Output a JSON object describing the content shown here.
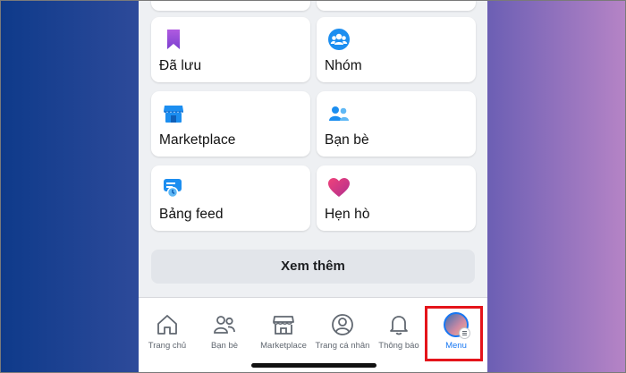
{
  "shortcuts": [
    {
      "label": "Đã lưu",
      "icon": "bookmark-icon"
    },
    {
      "label": "Nhóm",
      "icon": "groups-icon"
    },
    {
      "label": "Marketplace",
      "icon": "marketplace-shop-icon"
    },
    {
      "label": "Bạn bè",
      "icon": "friends-icon"
    },
    {
      "label": "Bảng feed",
      "icon": "feeds-icon"
    },
    {
      "label": "Hẹn hò",
      "icon": "dating-heart-icon"
    }
  ],
  "see_more_label": "Xem thêm",
  "tabbar": {
    "items": [
      {
        "label": "Trang chủ",
        "icon": "home-icon"
      },
      {
        "label": "Bạn bè",
        "icon": "friends-outline-icon"
      },
      {
        "label": "Marketplace",
        "icon": "shop-outline-icon"
      },
      {
        "label": "Trang cá nhân",
        "icon": "profile-icon"
      },
      {
        "label": "Thông báo",
        "icon": "bell-icon"
      },
      {
        "label": "Menu",
        "icon": "avatar-menu-icon"
      }
    ],
    "active_index": 5
  },
  "colors": {
    "accent": "#1877f2",
    "highlight": "#e4141b",
    "bookmark": "#8e44d6",
    "heart": "#e0245e"
  }
}
